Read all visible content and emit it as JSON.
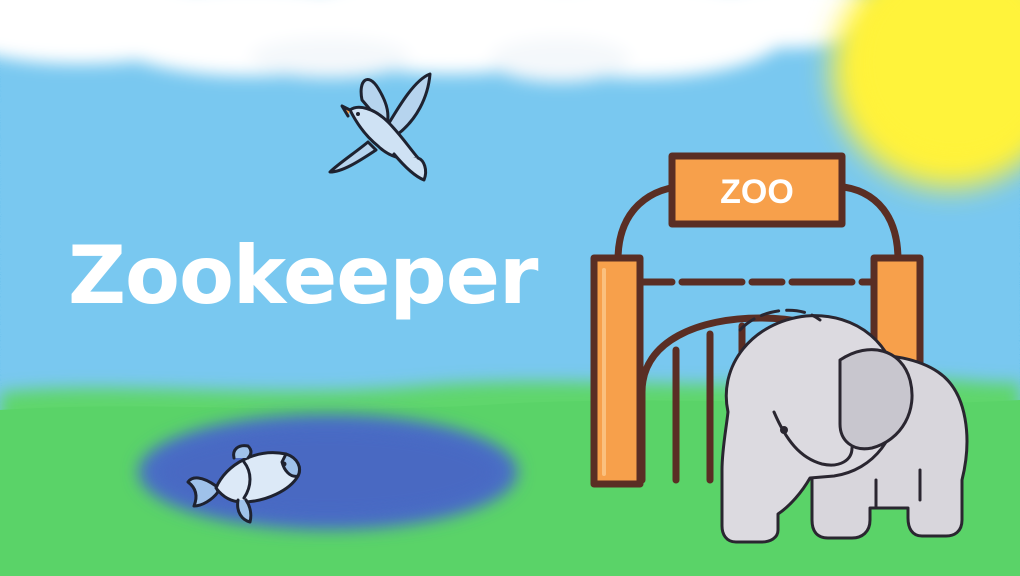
{
  "title": "Zookeeper",
  "gate_sign": "ZOO",
  "colors": {
    "sky": "#6ec3ee",
    "grass": "#5fd66c",
    "pond": "#4a6fc6",
    "sun": "#fff23a",
    "gate_orange": "#f7a04b",
    "gate_outline": "#5a2e24",
    "elephant": "#d8d6dc",
    "title": "#ffffff"
  },
  "icons": [
    "cloud-icon",
    "sun-icon",
    "bird-icon",
    "fish-icon",
    "zoo-gate-icon",
    "elephant-icon"
  ]
}
